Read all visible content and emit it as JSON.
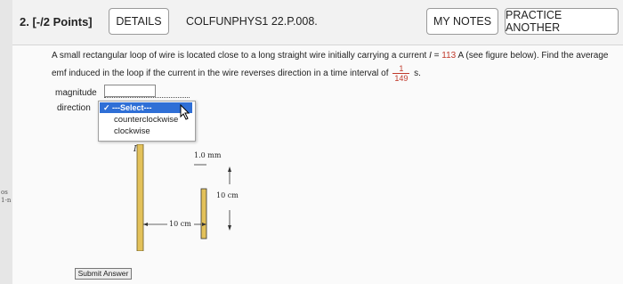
{
  "left_strip": {
    "frag1": "os",
    "frag2": "1-n"
  },
  "header": {
    "question_number": "2.",
    "points": "[-/2 Points]",
    "details_label": "DETAILS",
    "problem_code": "COLFUNPHYS1 22.P.008.",
    "my_notes_label": "MY NOTES",
    "practice_label": "PRACTICE ANOTHER"
  },
  "question": {
    "text_a": "A small rectangular loop of wire is located close to a long straight wire initially carrying a current ",
    "current_symbol": "I",
    "equals": " = ",
    "current_value": "113",
    "text_b": " A (see figure below). Find the average emf induced in the loop if the current in the wire reverses direction in a time interval of",
    "time_num": "1",
    "time_den": "149",
    "time_unit": "s."
  },
  "answers": {
    "magnitude_label": "magnitude",
    "direction_label": "direction",
    "dropdown_selected": "✓ ---Select---",
    "options": [
      "counterclockwise",
      "clockwise"
    ]
  },
  "figure": {
    "wire_label": "I",
    "gap_label": "1.0 mm",
    "height_label": "10 cm",
    "width_label": "10 cm"
  },
  "submit_label": "Submit Answer",
  "colors": {
    "highlight": "#2f6fd6",
    "value_red": "#c0392b",
    "wire_gold": "#e3c15a"
  }
}
